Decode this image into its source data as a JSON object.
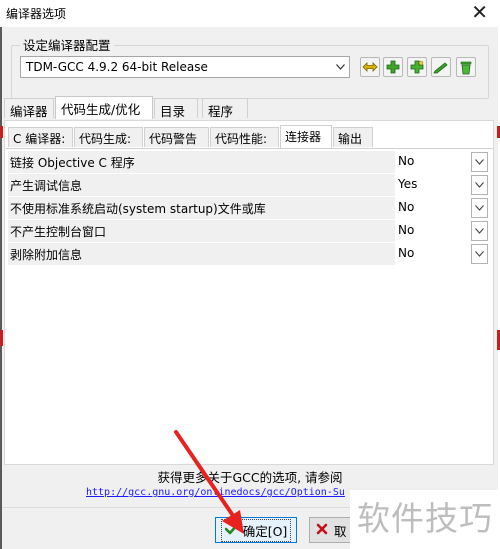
{
  "window": {
    "title": "编译器选项",
    "close_glyph": "✕"
  },
  "compiler_group": {
    "label": "设定编译器配置",
    "selected_profile": "TDM-GCC 4.9.2 64-bit Release",
    "toolbar_icons": [
      "star-swap-icon",
      "add-profile-icon",
      "add-profile-alt-icon",
      "rename-profile-icon",
      "delete-profile-icon"
    ]
  },
  "main_tabs": [
    {
      "label": "编译器",
      "active": false
    },
    {
      "label": "代码生成/优化",
      "active": true
    },
    {
      "label": "目录",
      "active": false
    },
    {
      "label": "程序",
      "active": false
    }
  ],
  "sub_tabs": [
    {
      "label": "C 编译器:",
      "active": false
    },
    {
      "label": "代码生成:",
      "active": false
    },
    {
      "label": "代码警告",
      "active": false
    },
    {
      "label": "代码性能:",
      "active": false
    },
    {
      "label": "连接器",
      "active": true
    },
    {
      "label": "输出",
      "active": false
    }
  ],
  "linker_options": [
    {
      "label": "链接 Objective C 程序",
      "value": "No"
    },
    {
      "label": "产生调试信息",
      "value": "Yes"
    },
    {
      "label": "不使用标准系统启动(system startup)文件或库",
      "value": "No"
    },
    {
      "label": "不产生控制台窗口",
      "value": "No"
    },
    {
      "label": "剥除附加信息",
      "value": "No"
    }
  ],
  "footer": {
    "info_text": "获得更多关于GCC的选项, 请参阅",
    "link_text": "http://gcc.gnu.org/onlinedocs/gcc/Option-Su"
  },
  "buttons": {
    "ok_label": "确定[O]",
    "cancel_label": "取"
  },
  "watermark": "软件技巧",
  "colors": {
    "accent": "#0078d7",
    "arrow": "#e8231f",
    "link": "#1a1aff"
  }
}
